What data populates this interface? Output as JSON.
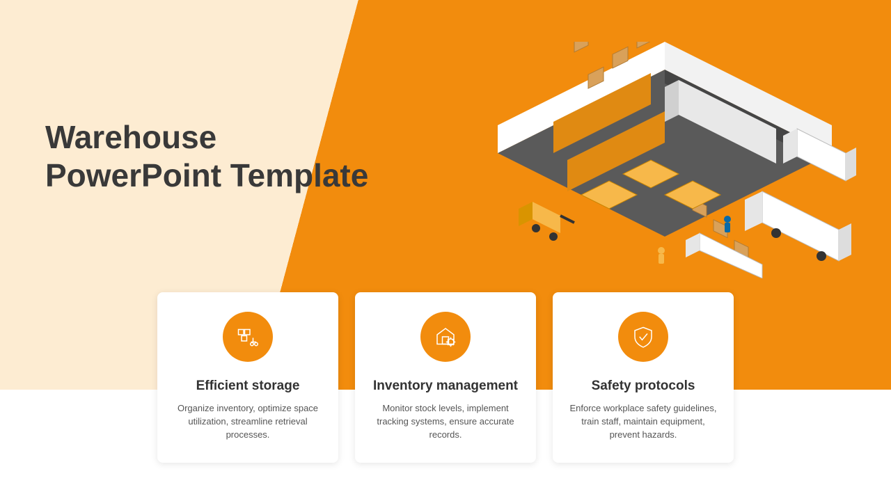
{
  "colors": {
    "accent": "#f28c0d",
    "cream": "#fdecd2",
    "heading": "#393939",
    "body": "#555555"
  },
  "title": "Warehouse\nPowerPoint Template",
  "illustration": {
    "name": "warehouse-isometric-illustration",
    "description": "Isometric cutaway warehouse with shelving racks of boxes, forklifts, workers, conveyor, loading docks and delivery trucks"
  },
  "cards": [
    {
      "icon": "forklift-boxes-icon",
      "title": "Efficient storage",
      "desc": "Organize inventory, optimize space utilization, streamline retrieval processes."
    },
    {
      "icon": "warehouse-gear-icon",
      "title": "Inventory management",
      "desc": "Monitor stock levels, implement tracking systems, ensure accurate records."
    },
    {
      "icon": "shield-check-icon",
      "title": "Safety protocols",
      "desc": "Enforce workplace safety guidelines, train staff, maintain equipment, prevent hazards."
    }
  ]
}
